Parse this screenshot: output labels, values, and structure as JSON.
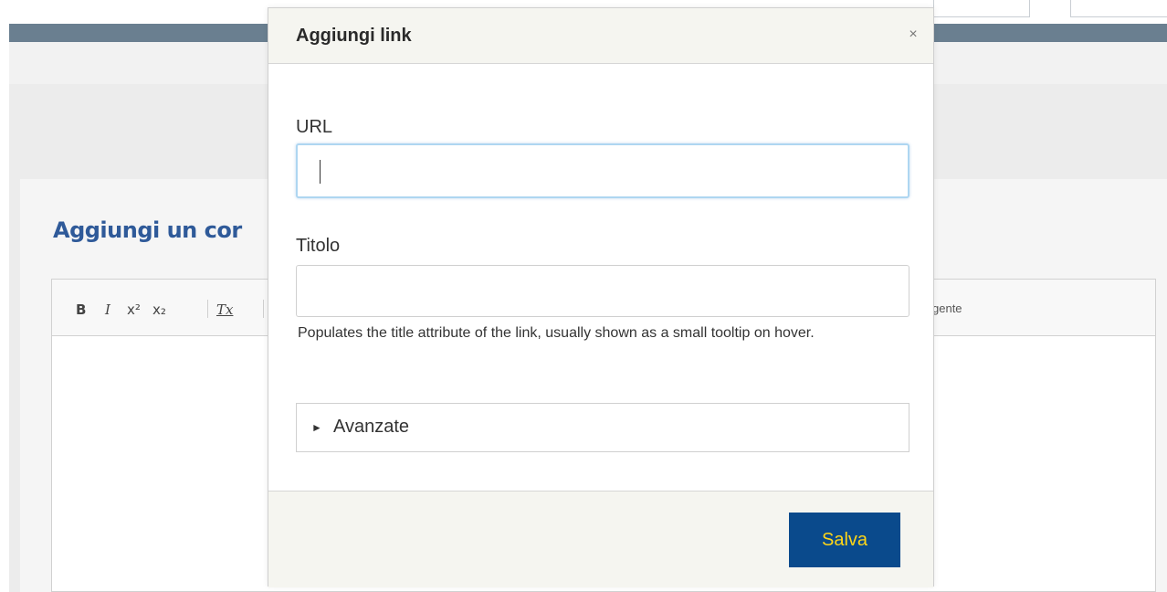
{
  "background": {
    "heading": "Aggiungi un cor",
    "toolbar": {
      "bold": "B",
      "italic": "I",
      "superscript": "x²",
      "subscript": "x₂",
      "remove_format": "Tx",
      "source_partial": "gente"
    }
  },
  "dialog": {
    "title": "Aggiungi link",
    "close_glyph": "×",
    "url_label": "URL",
    "url_value": "",
    "title_label": "Titolo",
    "title_value": "",
    "help_text": "Populates the title attribute of the link, usually shown as a small tooltip on hover.",
    "advanced_arrow": "►",
    "advanced_label": "Avanzate",
    "save_label": "Salva"
  },
  "colors": {
    "save_bg": "#0a4a8c",
    "save_text": "#ffd617",
    "heading": "#2f5a99",
    "nav": "#6a7f90"
  }
}
